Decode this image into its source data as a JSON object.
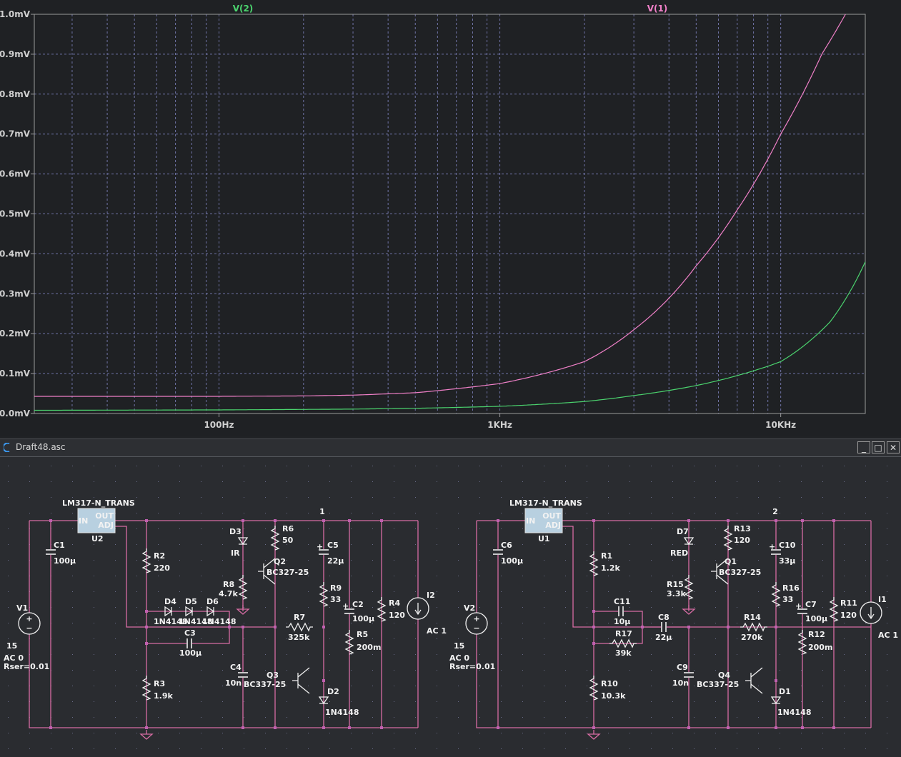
{
  "plot": {
    "traces": [
      {
        "name": "V(2)",
        "color": "#4bd36e"
      },
      {
        "name": "V(1)",
        "color": "#f080c8"
      }
    ],
    "y_ticks": [
      "0.0mV",
      "0.1mV",
      "0.2mV",
      "0.3mV",
      "0.4mV",
      "0.5mV",
      "0.6mV",
      "0.7mV",
      "0.8mV",
      "0.9mV",
      "1.0mV"
    ],
    "x_ticks": [
      {
        "label": "100Hz",
        "f": 100
      },
      {
        "label": "1KHz",
        "f": 1000
      },
      {
        "label": "10KHz",
        "f": 10000
      }
    ],
    "colors": {
      "grid": "#6f73a6",
      "background": "#1f2124",
      "axis": "#9a9a9a"
    }
  },
  "chart_data": {
    "type": "line",
    "xscale": "log",
    "xlim": [
      22,
      20000
    ],
    "ylim": [
      0,
      1.0
    ],
    "yunit": "mV",
    "series": [
      {
        "name": "V(2)",
        "x": [
          22,
          100,
          300,
          500,
          1000,
          2000,
          3000,
          5000,
          7000,
          10000,
          15000,
          20000
        ],
        "values": [
          0.008,
          0.009,
          0.011,
          0.013,
          0.018,
          0.03,
          0.045,
          0.07,
          0.095,
          0.13,
          0.23,
          0.38
        ]
      },
      {
        "name": "V(1)",
        "x": [
          22,
          100,
          200,
          300,
          500,
          1000,
          2000,
          3000,
          5000,
          7000,
          10000,
          14000,
          17000
        ],
        "values": [
          0.043,
          0.043,
          0.044,
          0.046,
          0.052,
          0.075,
          0.13,
          0.21,
          0.37,
          0.51,
          0.7,
          0.9,
          1.0
        ]
      }
    ]
  },
  "schematic": {
    "window_title": "Draft48.asc",
    "buttons": {
      "minimize": "_",
      "maximize": "□",
      "close": "✕"
    },
    "colors": {
      "wire": "#d86ca4",
      "component": "#f0f0f0",
      "node": "#c060b0",
      "ground": "#d86ca4",
      "grid": "#6a6d8a"
    },
    "left": {
      "reg_name": "LM317-N_TRANS",
      "reg_ref": "U2",
      "pin_in": "IN",
      "pin_out": "OUT",
      "pin_adj": "ADJ",
      "node_label": "1",
      "C1": [
        "C1",
        "100µ"
      ],
      "V1": [
        "V1",
        "15",
        "AC 0",
        "Rser=0.01"
      ],
      "R2": [
        "R2",
        "220"
      ],
      "R3": [
        "R3",
        "1.9k"
      ],
      "D4": "D4",
      "D5": "D5",
      "D6": "D6",
      "diode_model": "1N4148",
      "C3": [
        "C3",
        "100µ"
      ],
      "D3": [
        "D3",
        "IR"
      ],
      "R8": [
        "R8",
        "4.7k"
      ],
      "R6": [
        "R6",
        "50"
      ],
      "Q2": [
        "Q2",
        "BC327-25"
      ],
      "R7": [
        "R7",
        "325k"
      ],
      "C4": [
        "C4",
        "10n"
      ],
      "Q3": [
        "Q3",
        "BC337-25"
      ],
      "C5": [
        "C5",
        "22µ"
      ],
      "R9": [
        "R9",
        "33"
      ],
      "D2": [
        "D2",
        "1N4148"
      ],
      "C2": [
        "C2",
        "100µ"
      ],
      "R5": [
        "R5",
        "200m"
      ],
      "R4": [
        "R4",
        "120"
      ],
      "I2": [
        "I2",
        "AC 1"
      ]
    },
    "right": {
      "reg_name": "LM317-N_TRANS",
      "reg_ref": "U1",
      "pin_in": "IN",
      "pin_out": "OUT",
      "pin_adj": "ADJ",
      "node_label": "2",
      "C6": [
        "C6",
        "100µ"
      ],
      "V2": [
        "V2",
        "15",
        "AC 0",
        "Rser=0.01"
      ],
      "R1": [
        "R1",
        "1.2k"
      ],
      "R10": [
        "R10",
        "10.3k"
      ],
      "C11": [
        "C11",
        "10µ"
      ],
      "R17": [
        "R17",
        "39k"
      ],
      "C8": [
        "C8",
        "22µ"
      ],
      "D7": [
        "D7",
        "RED"
      ],
      "R15": [
        "R15",
        "3.3k"
      ],
      "R13": [
        "R13",
        "120"
      ],
      "Q1": [
        "Q1",
        "BC327-25"
      ],
      "R14": [
        "R14",
        "270k"
      ],
      "C9": [
        "C9",
        "10n"
      ],
      "Q4": [
        "Q4",
        "BC337-25"
      ],
      "C10": [
        "C10",
        "33µ"
      ],
      "R16": [
        "R16",
        "33"
      ],
      "D1": [
        "D1",
        "1N4148"
      ],
      "C7": [
        "C7",
        "100µ"
      ],
      "R12": [
        "R12",
        "200m"
      ],
      "R11": [
        "R11",
        "120"
      ],
      "I1": [
        "I1",
        "AC 1"
      ]
    }
  }
}
